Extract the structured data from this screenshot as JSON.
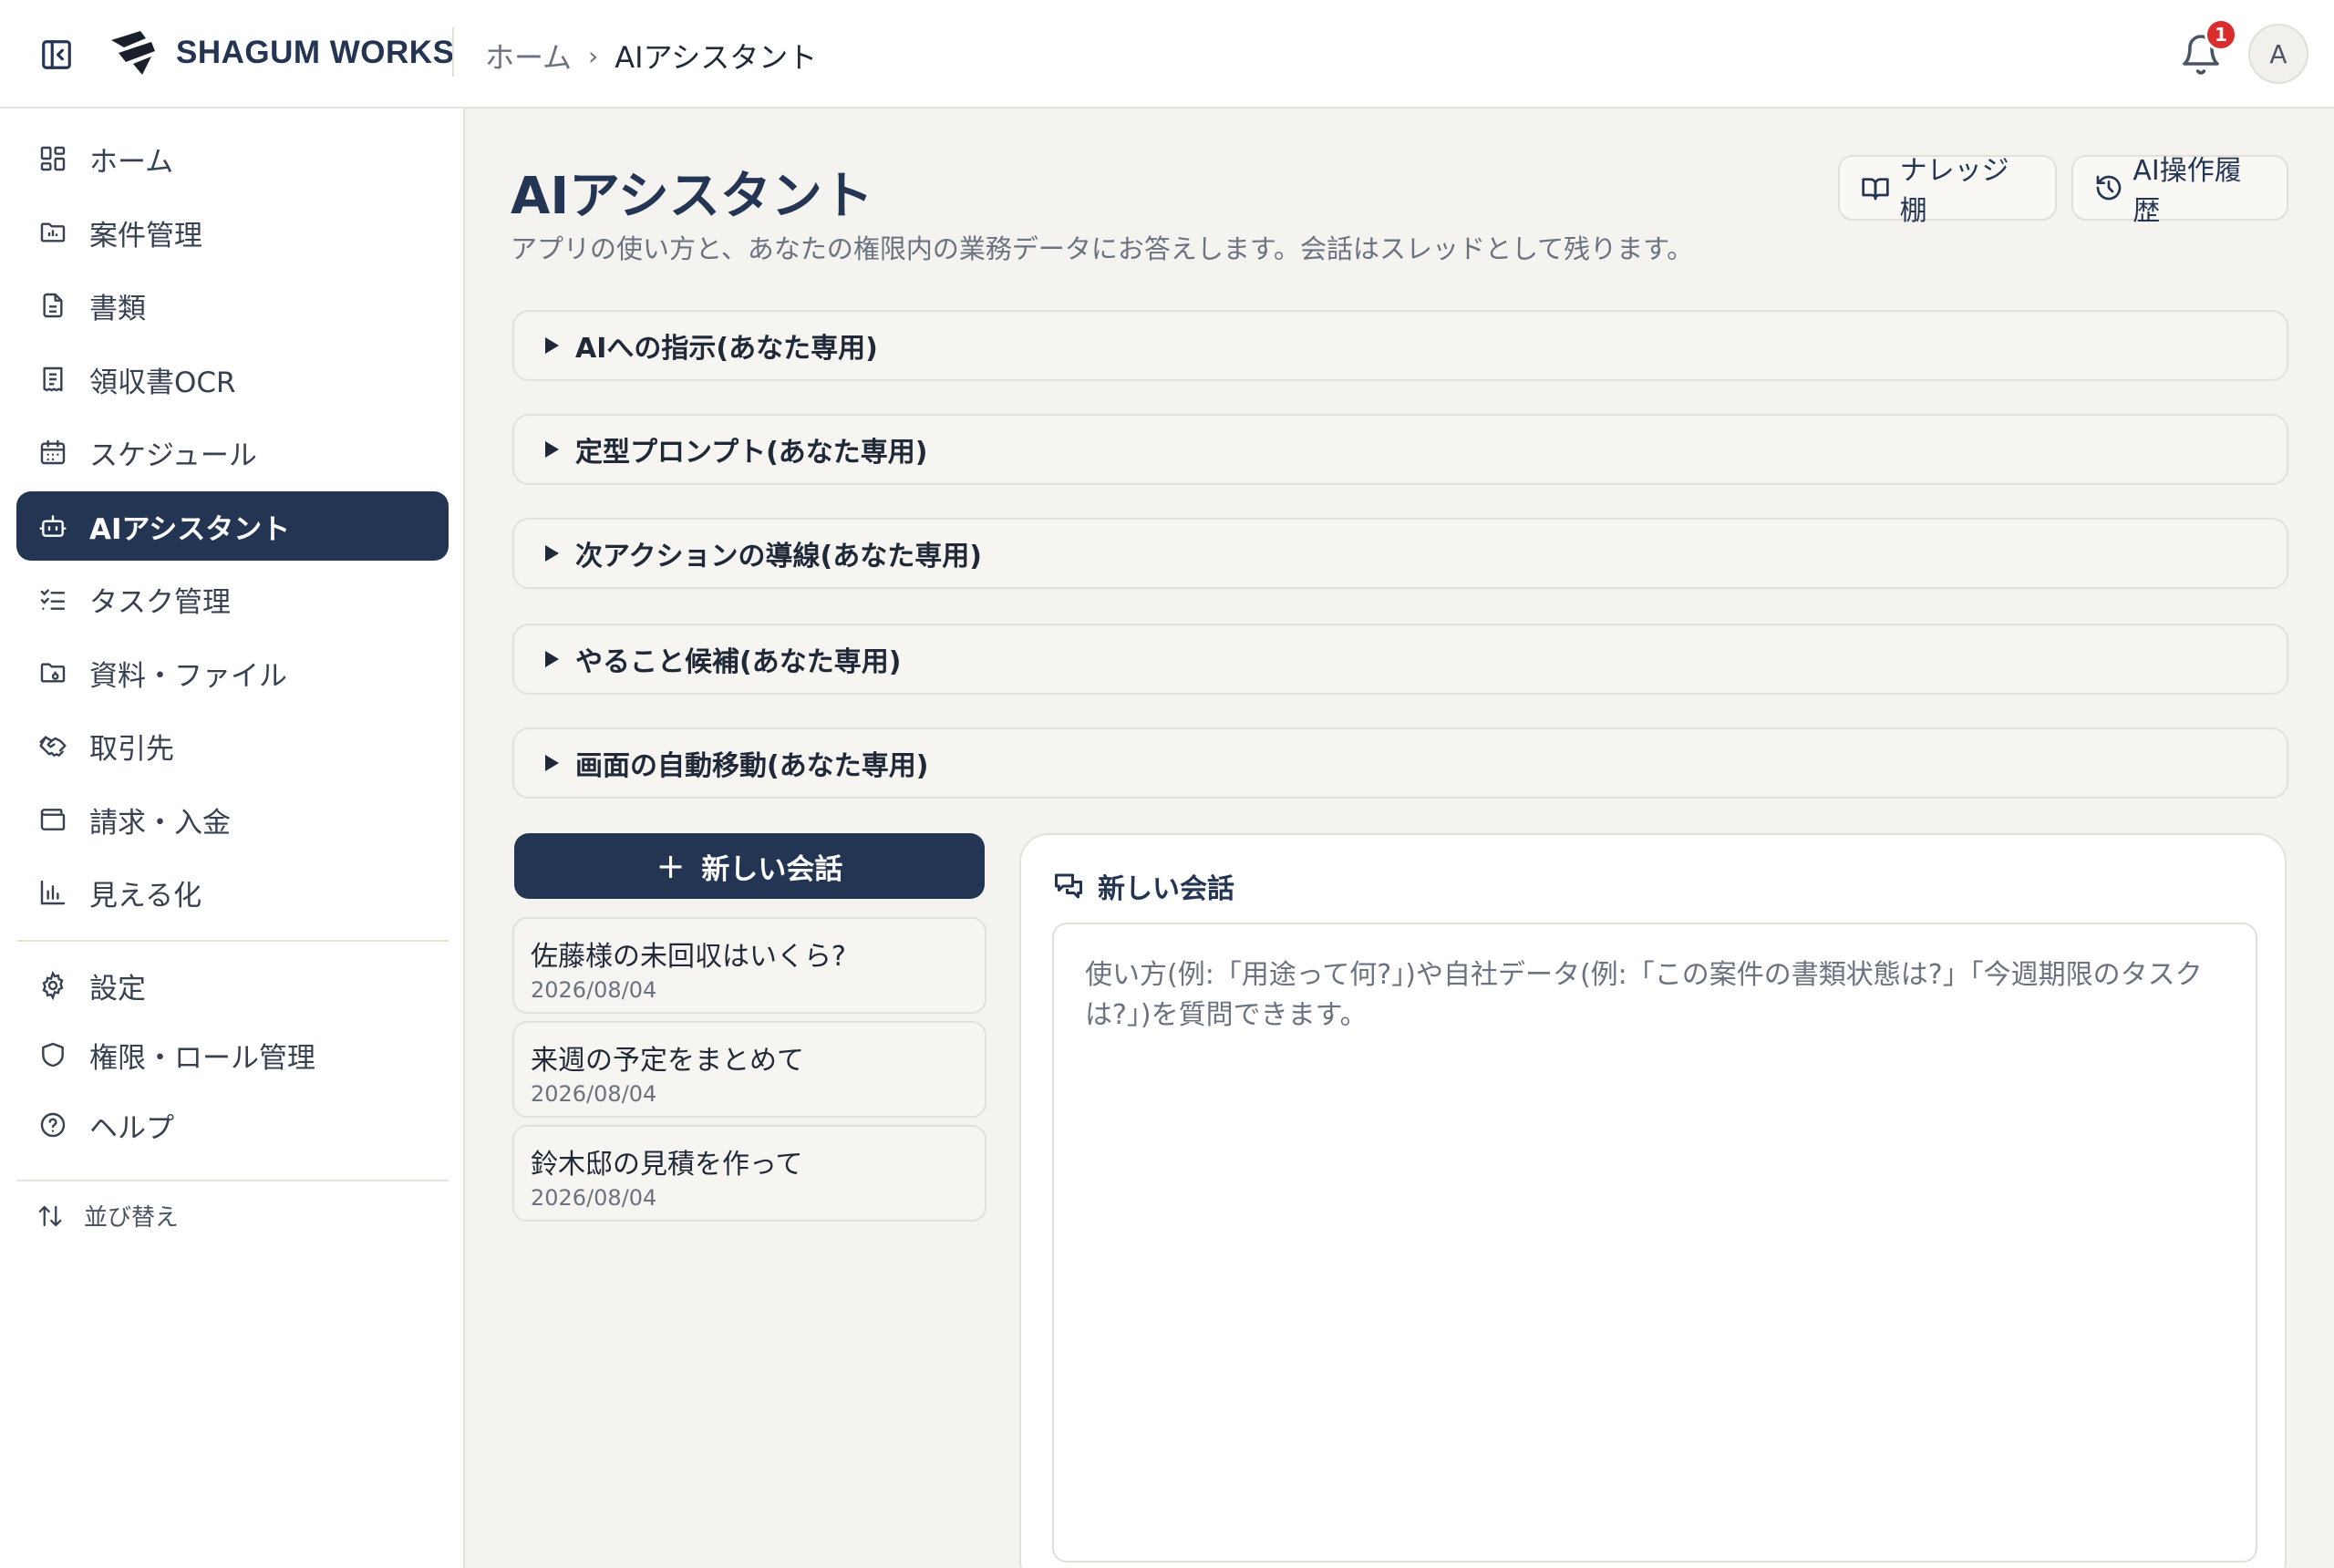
{
  "header": {
    "brand": "SHAGUM WORKS",
    "breadcrumb": {
      "home": "ホーム",
      "separator": "›",
      "current": "AIアシスタント"
    },
    "notification_count": "1",
    "avatar_initial": "A"
  },
  "sidebar": {
    "items": [
      {
        "label": "ホーム",
        "icon": "grid-icon"
      },
      {
        "label": "案件管理",
        "icon": "folder-chart-icon"
      },
      {
        "label": "書類",
        "icon": "document-icon"
      },
      {
        "label": "領収書OCR",
        "icon": "receipt-icon"
      },
      {
        "label": "スケジュール",
        "icon": "calendar-icon"
      },
      {
        "label": "AIアシスタント",
        "icon": "bot-icon",
        "active": true
      },
      {
        "label": "タスク管理",
        "icon": "checklist-icon"
      },
      {
        "label": "資料・ファイル",
        "icon": "folder-file-icon"
      },
      {
        "label": "取引先",
        "icon": "handshake-icon"
      },
      {
        "label": "請求・入金",
        "icon": "wallet-icon"
      },
      {
        "label": "見える化",
        "icon": "bar-chart-icon"
      }
    ],
    "settings_items": [
      {
        "label": "設定",
        "icon": "gear-icon"
      },
      {
        "label": "権限・ロール管理",
        "icon": "shield-icon"
      },
      {
        "label": "ヘルプ",
        "icon": "help-icon"
      }
    ],
    "reorder_label": "並び替え"
  },
  "main": {
    "title": "AIアシスタント",
    "description": "アプリの使い方と、あなたの権限内の業務データにお答えします。会話はスレッドとして残ります。",
    "knowledge_button": "ナレッジ棚",
    "history_button": "AI操作履歴",
    "accordions": [
      "AIへの指示(あなた専用)",
      "定型プロンプト(あなた専用)",
      "次アクションの導線(あなた専用)",
      "やること候補(あなた専用)",
      "画面の自動移動(あなた専用)"
    ],
    "new_conversation_button": "新しい会話",
    "threads": [
      {
        "title": "佐藤様の未回収はいくら?",
        "date": "2026/08/04"
      },
      {
        "title": "来週の予定をまとめて",
        "date": "2026/08/04"
      },
      {
        "title": "鈴木邸の見積を作って",
        "date": "2026/08/04"
      }
    ],
    "chat": {
      "title": "新しい会話",
      "placeholder": "使い方(例:「用途って何?」)や自社データ(例:「この案件の書類状態は?」「今週期限のタスクは?」)を質問できます。"
    }
  },
  "colors": {
    "navy": "#243554",
    "background": "#f5f3ef",
    "badge": "#d92d2d"
  }
}
